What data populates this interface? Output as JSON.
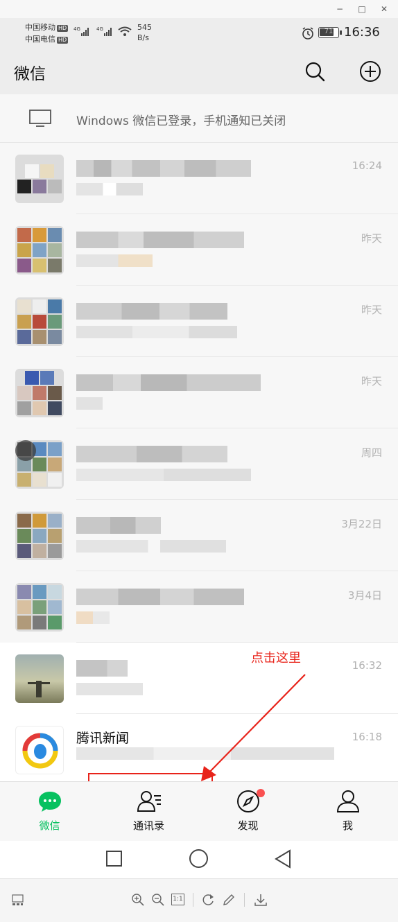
{
  "window": {
    "minimize_glyph": "−",
    "maximize_glyph": "□",
    "close_glyph": "✕"
  },
  "status": {
    "carrier1": "中国移动",
    "carrier2": "中国电信",
    "hd": "HD",
    "net1": "4G",
    "net2": "4G",
    "speed_value": "545",
    "speed_unit": "B/s",
    "battery": "71",
    "time": "16:36",
    "icons": [
      "alarm-icon",
      "battery-icon",
      "wifi-icon",
      "signal-icon"
    ]
  },
  "header": {
    "title": "微信",
    "icons": [
      "search-icon",
      "add-circle-icon"
    ]
  },
  "notice": {
    "text": "Windows 微信已登录，手机通知已关闭",
    "icon": "monitor-icon"
  },
  "chats": [
    {
      "time": "16:24"
    },
    {
      "time": "昨天"
    },
    {
      "time": "昨天"
    },
    {
      "time": "昨天"
    },
    {
      "time": "周四"
    },
    {
      "time": "3月22日"
    },
    {
      "time": "3月4日"
    },
    {
      "time": "16:32"
    },
    {
      "name": "腾讯新闻",
      "time": "16:18"
    }
  ],
  "annotation": {
    "text": "点击这里",
    "color": "#e8231a"
  },
  "tabs": [
    {
      "label": "微信",
      "icon": "chat-bubble-icon",
      "active": true
    },
    {
      "label": "通讯录",
      "icon": "contacts-icon",
      "active": false
    },
    {
      "label": "发现",
      "icon": "compass-icon",
      "active": false,
      "badge": true
    },
    {
      "label": "我",
      "icon": "person-icon",
      "active": false
    }
  ],
  "colors": {
    "accent": "#07c160",
    "badge": "#fa5151",
    "annotation": "#e8231a"
  },
  "viewer_toolbar": {
    "icons": [
      "thumbnail-icon",
      "zoom-in-icon",
      "zoom-out-icon",
      "actual-size-icon",
      "rotate-icon",
      "edit-icon",
      "download-icon"
    ],
    "actual_size_label": "1:1"
  }
}
